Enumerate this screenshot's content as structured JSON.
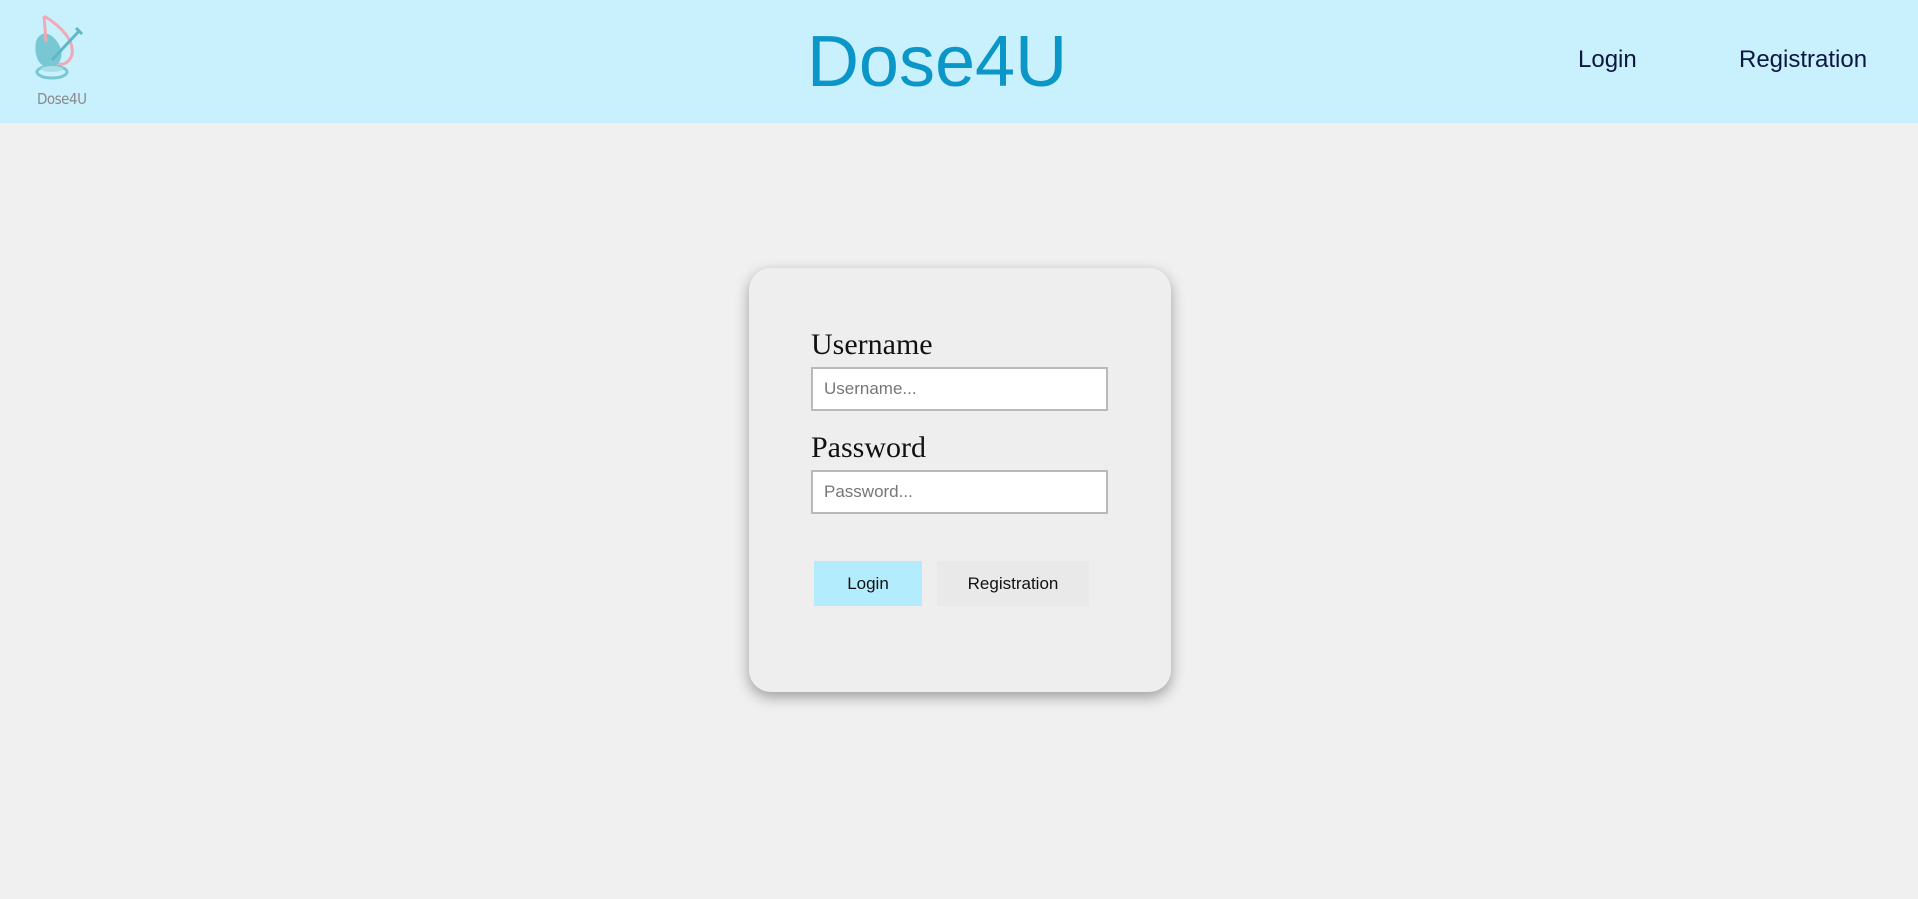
{
  "header": {
    "logo_text": "Dose4U",
    "title": "Dose4U",
    "nav": {
      "login": "Login",
      "registration": "Registration"
    }
  },
  "login_form": {
    "username_label": "Username",
    "username_placeholder": "Username...",
    "password_label": "Password",
    "password_placeholder": "Password...",
    "login_button": "Login",
    "registration_button": "Registration"
  },
  "colors": {
    "header_bg": "#c9f0fd",
    "title": "#0a96c7",
    "page_bg": "#f0f0f0",
    "login_button_bg": "#b2ecfd"
  }
}
